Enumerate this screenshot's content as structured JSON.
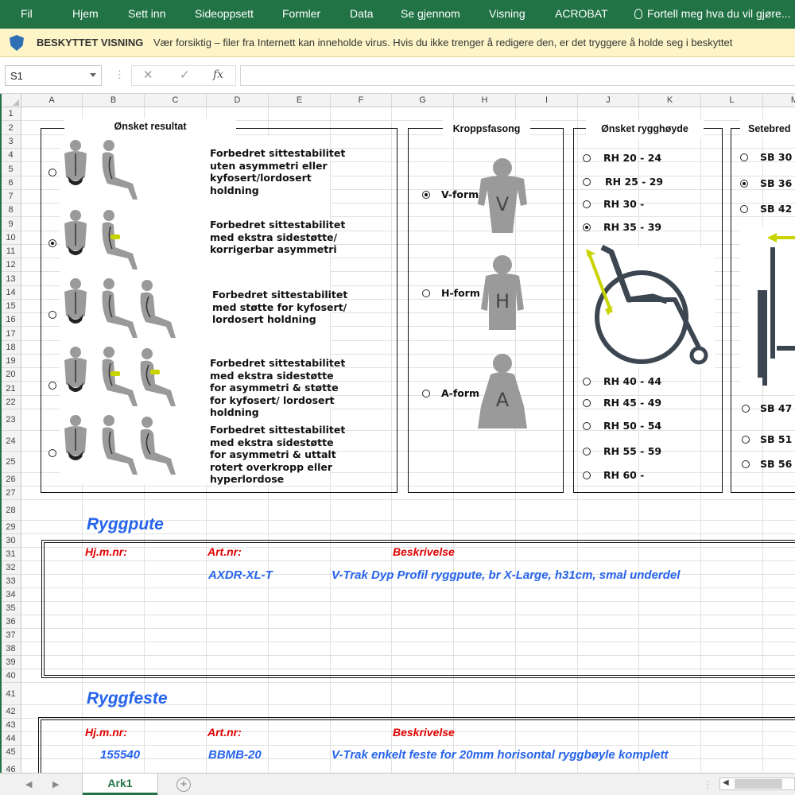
{
  "ribbon": {
    "tabs": [
      "Fil",
      "Hjem",
      "Sett inn",
      "Sideoppsett",
      "Formler",
      "Data",
      "Se gjennom",
      "Visning",
      "ACROBAT"
    ],
    "tell_me": "Fortell meg hva du vil gjøre..."
  },
  "protected_view": {
    "title": "BESKYTTET VISNING",
    "message": "Vær forsiktig – filer fra Internett kan inneholde virus. Hvis du ikke trenger å redigere den, er det tryggere å holde seg i beskyttet"
  },
  "formula_bar": {
    "name_box": "S1",
    "cancel_icon": "✕",
    "enter_icon": "✓",
    "fx_label": "fx",
    "dots": "⋮"
  },
  "grid": {
    "columns": [
      "A",
      "B",
      "C",
      "D",
      "E",
      "F",
      "G",
      "H",
      "I",
      "J",
      "K",
      "L",
      "M"
    ],
    "rows": [
      "1",
      "2",
      "3",
      "4",
      "5",
      "6",
      "7",
      "8",
      "9",
      "10",
      "11",
      "12",
      "13",
      "14",
      "15",
      "16",
      "17",
      "18",
      "19",
      "20",
      "21",
      "22",
      "23",
      "24",
      "25",
      "26",
      "27",
      "28",
      "29",
      "30",
      "31",
      "32",
      "33",
      "34",
      "35",
      "36",
      "37",
      "38",
      "39",
      "40",
      "41",
      "42",
      "43",
      "44",
      "45",
      "46"
    ]
  },
  "panels": {
    "result": {
      "title": "Ønsket resultat",
      "options": [
        {
          "label": "Forbedret sittestabilitet uten asymmetri eller kyfosert/lordosert holdning",
          "selected": false
        },
        {
          "label": "Forbedret sittestabilitet med ekstra sidestøtte/ korrigerbar asymmetri",
          "selected": true
        },
        {
          "label": "Forbedret sittestabilitet med støtte for kyfosert/ lordosert holdning",
          "selected": false
        },
        {
          "label": "Forbedret sittestabilitet med ekstra sidestøtte for asymmetri & støtte for kyfosert/ lordosert holdning",
          "selected": false
        },
        {
          "label": "Forbedret sittestabilitet med ekstra sidestøtte for asymmetri & uttalt rotert overkropp eller hyperlordose",
          "selected": false
        }
      ]
    },
    "body": {
      "title": "Kroppsfasong",
      "options": [
        {
          "label": "V-form",
          "letter": "V",
          "selected": true
        },
        {
          "label": "H-form",
          "letter": "H",
          "selected": false
        },
        {
          "label": "A-form",
          "letter": "A",
          "selected": false
        }
      ]
    },
    "back_height": {
      "title": "Ønsket rygghøyde",
      "options": [
        {
          "label": "RH 20 - 24",
          "selected": false
        },
        {
          "label": "RH 25 - 29",
          "selected": false
        },
        {
          "label": "RH 30 -",
          "selected": false
        },
        {
          "label": "RH 35 - 39",
          "selected": true
        },
        {
          "label": "RH 40 - 44",
          "selected": false
        },
        {
          "label": "RH 45 - 49",
          "selected": false
        },
        {
          "label": "RH 50 - 54",
          "selected": false
        },
        {
          "label": "RH 55 - 59",
          "selected": false
        },
        {
          "label": "RH 60 -",
          "selected": false
        }
      ]
    },
    "seat_width": {
      "title": "Setebred",
      "options": [
        {
          "label": "SB 30 -",
          "selected": false
        },
        {
          "label": "SB 36 -",
          "selected": true
        },
        {
          "label": "SB 42 -",
          "selected": false
        },
        {
          "label": "SB 47 -",
          "selected": false
        },
        {
          "label": "SB 51 -",
          "selected": false
        },
        {
          "label": "SB 56 -",
          "selected": false
        }
      ]
    }
  },
  "sections": {
    "ryggpute": {
      "title": "Ryggpute",
      "col1": "Hj.m.nr:",
      "col2": "Art.nr:",
      "col3": "Beskrivelse",
      "hjmnr": "",
      "artnr": "AXDR-XL-T",
      "beskrivelse": "V-Trak Dyp Profil ryggpute, br X-Large, h31cm, smal underdel"
    },
    "ryggfeste": {
      "title": "Ryggfeste",
      "col1": "Hj.m.nr:",
      "col2": "Art.nr:",
      "col3": "Beskrivelse",
      "hjmnr": "155540",
      "artnr": "BBMB-20",
      "beskrivelse": "V-Trak enkelt feste for 20mm horisontal ryggbøyle komplett"
    }
  },
  "sheet_tabs": {
    "active": "Ark1",
    "add": "+"
  },
  "colors": {
    "excel_green": "#217346",
    "accent_blue": "#2563eb",
    "header_red": "#e00000",
    "lime": "#c8d400",
    "figure_gray": "#9a9a9a"
  }
}
